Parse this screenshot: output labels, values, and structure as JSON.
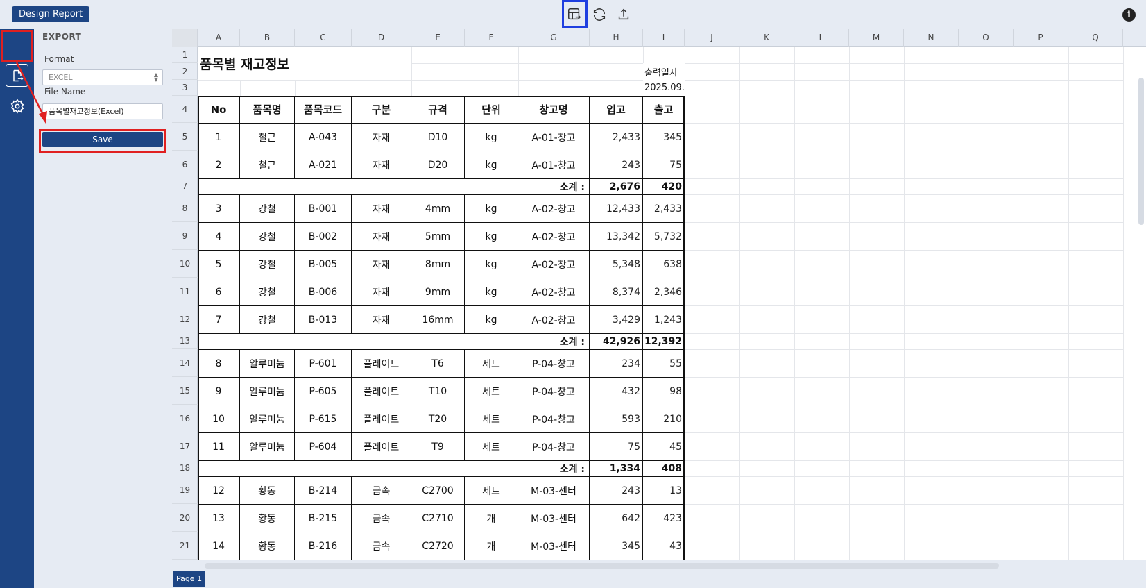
{
  "toolbar": {
    "design_report_label": "Design Report",
    "icons": [
      "table-export-icon",
      "refresh-icon",
      "upload-icon",
      "info-icon"
    ],
    "info_glyph": "i"
  },
  "sidebar": {
    "items": [
      "export-icon",
      "settings-icon"
    ]
  },
  "export_panel": {
    "title": "EXPORT",
    "format_label": "Format",
    "format_value": "EXCEL",
    "file_name_label": "File Name",
    "file_name_value": "품목별재고정보(Excel)",
    "save_label": "Save"
  },
  "sheet": {
    "columns": [
      "A",
      "B",
      "C",
      "D",
      "E",
      "F",
      "G",
      "H",
      "I",
      "J",
      "K",
      "L",
      "M",
      "N",
      "O",
      "P",
      "Q"
    ],
    "rows": [
      "1",
      "2",
      "3",
      "4",
      "5",
      "6",
      "7",
      "8",
      "9",
      "10",
      "11",
      "12",
      "13",
      "14",
      "15",
      "16",
      "17",
      "18",
      "19",
      "20",
      "21"
    ],
    "title": "품목별 재고정보",
    "output_date_label": "출력일자",
    "output_date_value": "2025.09.",
    "headers": [
      "No",
      "품목명",
      "품목코드",
      "구분",
      "규격",
      "단위",
      "창고명",
      "입고",
      "출고"
    ],
    "subtotal_label": "소계 :",
    "data_rows": [
      [
        "1",
        "철근",
        "A-043",
        "자재",
        "D10",
        "kg",
        "A-01-창고",
        "2,433",
        "345"
      ],
      [
        "2",
        "철근",
        "A-021",
        "자재",
        "D20",
        "kg",
        "A-01-창고",
        "243",
        "75"
      ],
      [
        "3",
        "강철",
        "B-001",
        "자재",
        "4mm",
        "kg",
        "A-02-창고",
        "12,433",
        "2,433"
      ],
      [
        "4",
        "강철",
        "B-002",
        "자재",
        "5mm",
        "kg",
        "A-02-창고",
        "13,342",
        "5,732"
      ],
      [
        "5",
        "강철",
        "B-005",
        "자재",
        "8mm",
        "kg",
        "A-02-창고",
        "5,348",
        "638"
      ],
      [
        "6",
        "강철",
        "B-006",
        "자재",
        "9mm",
        "kg",
        "A-02-창고",
        "8,374",
        "2,346"
      ],
      [
        "7",
        "강철",
        "B-013",
        "자재",
        "16mm",
        "kg",
        "A-02-창고",
        "3,429",
        "1,243"
      ],
      [
        "8",
        "알루미늄",
        "P-601",
        "플레이트",
        "T6",
        "세트",
        "P-04-창고",
        "234",
        "55"
      ],
      [
        "9",
        "알루미늄",
        "P-605",
        "플레이트",
        "T10",
        "세트",
        "P-04-창고",
        "432",
        "98"
      ],
      [
        "10",
        "알루미늄",
        "P-615",
        "플레이트",
        "T20",
        "세트",
        "P-04-창고",
        "593",
        "210"
      ],
      [
        "11",
        "알루미늄",
        "P-604",
        "플레이트",
        "T9",
        "세트",
        "P-04-창고",
        "75",
        "45"
      ],
      [
        "12",
        "황동",
        "B-214",
        "금속",
        "C2700",
        "세트",
        "M-03-센터",
        "243",
        "13"
      ],
      [
        "13",
        "황동",
        "B-215",
        "금속",
        "C2710",
        "개",
        "M-03-센터",
        "642",
        "423"
      ],
      [
        "14",
        "황동",
        "B-216",
        "금속",
        "C2720",
        "개",
        "M-03-센터",
        "345",
        "43"
      ]
    ],
    "subtotals": [
      [
        "2,676",
        "420"
      ],
      [
        "42,926",
        "12,392"
      ],
      [
        "1,334",
        "408"
      ]
    ]
  },
  "footer": {
    "page_tab": "Page 1"
  }
}
